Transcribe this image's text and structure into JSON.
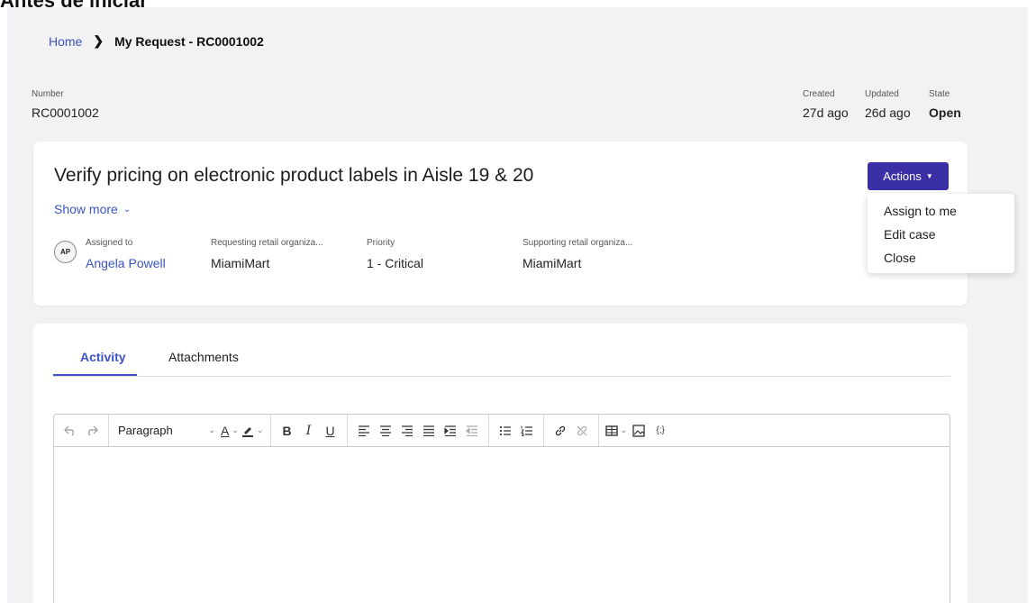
{
  "caption": "Antes de iniciar",
  "breadcrumb": {
    "home": "Home",
    "separator": "❯",
    "current": "My Request - RC0001002"
  },
  "record": {
    "number_label": "Number",
    "number_value": "RC0001002",
    "created_label": "Created",
    "created_value": "27d ago",
    "updated_label": "Updated",
    "updated_value": "26d ago",
    "state_label": "State",
    "state_value": "Open"
  },
  "case": {
    "title": "Verify pricing on electronic product labels in Aisle 19 & 20",
    "show_more": "Show more",
    "actions_label": "Actions",
    "avatar_initials": "AP",
    "fields": [
      {
        "label": "Assigned to",
        "value": "Angela Powell"
      },
      {
        "label": "Requesting retail organiza...",
        "value": "MiamiMart"
      },
      {
        "label": "Priority",
        "value": "1 - Critical"
      },
      {
        "label": "Supporting retail organiza...",
        "value": "MiamiMart"
      }
    ]
  },
  "actions_menu": {
    "items": [
      "Assign to me",
      "Edit case",
      "Close"
    ]
  },
  "tabs": [
    {
      "label": "Activity",
      "active": true
    },
    {
      "label": "Attachments",
      "active": false
    }
  ],
  "editor": {
    "block_format": "Paragraph",
    "text_color_glyph": "A",
    "bold_glyph": "B",
    "italic_glyph": "I",
    "underline_glyph": "U",
    "source_code_glyph": "{;}",
    "icons": [
      "undo-icon",
      "redo-icon",
      "text-color-icon",
      "highlight-icon",
      "bold-icon",
      "italic-icon",
      "underline-icon",
      "align-left-icon",
      "align-center-icon",
      "align-right-icon",
      "justify-icon",
      "indent-icon",
      "outdent-icon",
      "bullet-list-icon",
      "numbered-list-icon",
      "link-icon",
      "unlink-icon",
      "table-icon",
      "image-icon",
      "source-code-icon"
    ]
  },
  "colors": {
    "accent": "#3a53c5",
    "button": "#3b2fa5",
    "background": "#f2f2f4"
  }
}
